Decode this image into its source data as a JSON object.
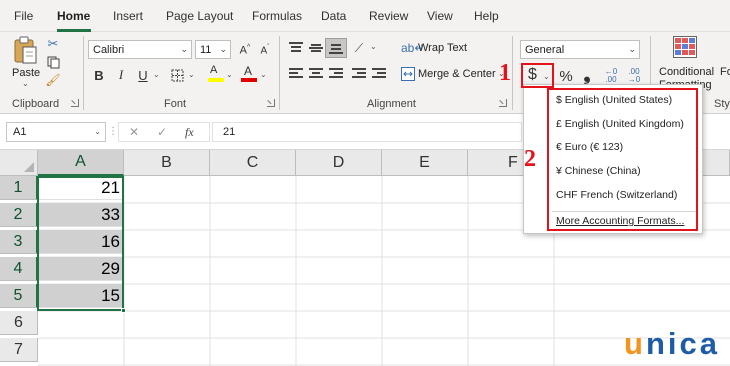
{
  "menu_tabs": [
    "File",
    "Home",
    "Insert",
    "Page Layout",
    "Formulas",
    "Data",
    "Review",
    "View",
    "Help"
  ],
  "ribbon": {
    "clipboard": {
      "paste_label": "Paste",
      "group_label": "Clipboard"
    },
    "font": {
      "font_name": "Calibri",
      "font_size": "11",
      "bold": "B",
      "italic": "I",
      "underline": "U",
      "font_color_glyph": "A",
      "highlight_glyph": "A",
      "group_label": "Font"
    },
    "alignment": {
      "wrap_text_label": "Wrap Text",
      "merge_center_label": "Merge & Center",
      "group_label": "Alignment"
    },
    "number": {
      "format_value": "General",
      "currency_symbol": "$",
      "percent_symbol": "%",
      "comma_symbol": "❟",
      "increase_decimal": "←0 .00",
      "decrease_decimal": ".00 →0"
    },
    "styles": {
      "conditional_formatting_line1": "Conditional",
      "conditional_formatting_line2": "Formatting",
      "format_as_table_prefix": "Fo",
      "group_label_fragment": "Sty"
    }
  },
  "formula_bar": {
    "name_box": "A1",
    "cancel_glyph": "✕",
    "enter_glyph": "✓",
    "fx_label": "fx",
    "formula_value": "21"
  },
  "grid": {
    "columns": [
      "A",
      "B",
      "C",
      "D",
      "E",
      "F"
    ],
    "rows": [
      "1",
      "2",
      "3",
      "4",
      "5",
      "6",
      "7"
    ],
    "values": [
      "21",
      "33",
      "16",
      "29",
      "15"
    ]
  },
  "accounting_dropdown": {
    "items": [
      "$ English (United States)",
      "£ English (United Kingdom)",
      "€ Euro (€ 123)",
      "¥ Chinese (China)",
      "CHF French (Switzerland)"
    ],
    "more_label": "More Accounting Formats..."
  },
  "annotations": {
    "step1": "1",
    "step2": "2",
    "accent_color": "#e3121b"
  },
  "logo": {
    "u": "u",
    "rest": "nica"
  },
  "colors": {
    "excel_green": "#217346",
    "selection_fill": "#d0d0d0",
    "ribbon_bg": "#f3f2f1"
  }
}
